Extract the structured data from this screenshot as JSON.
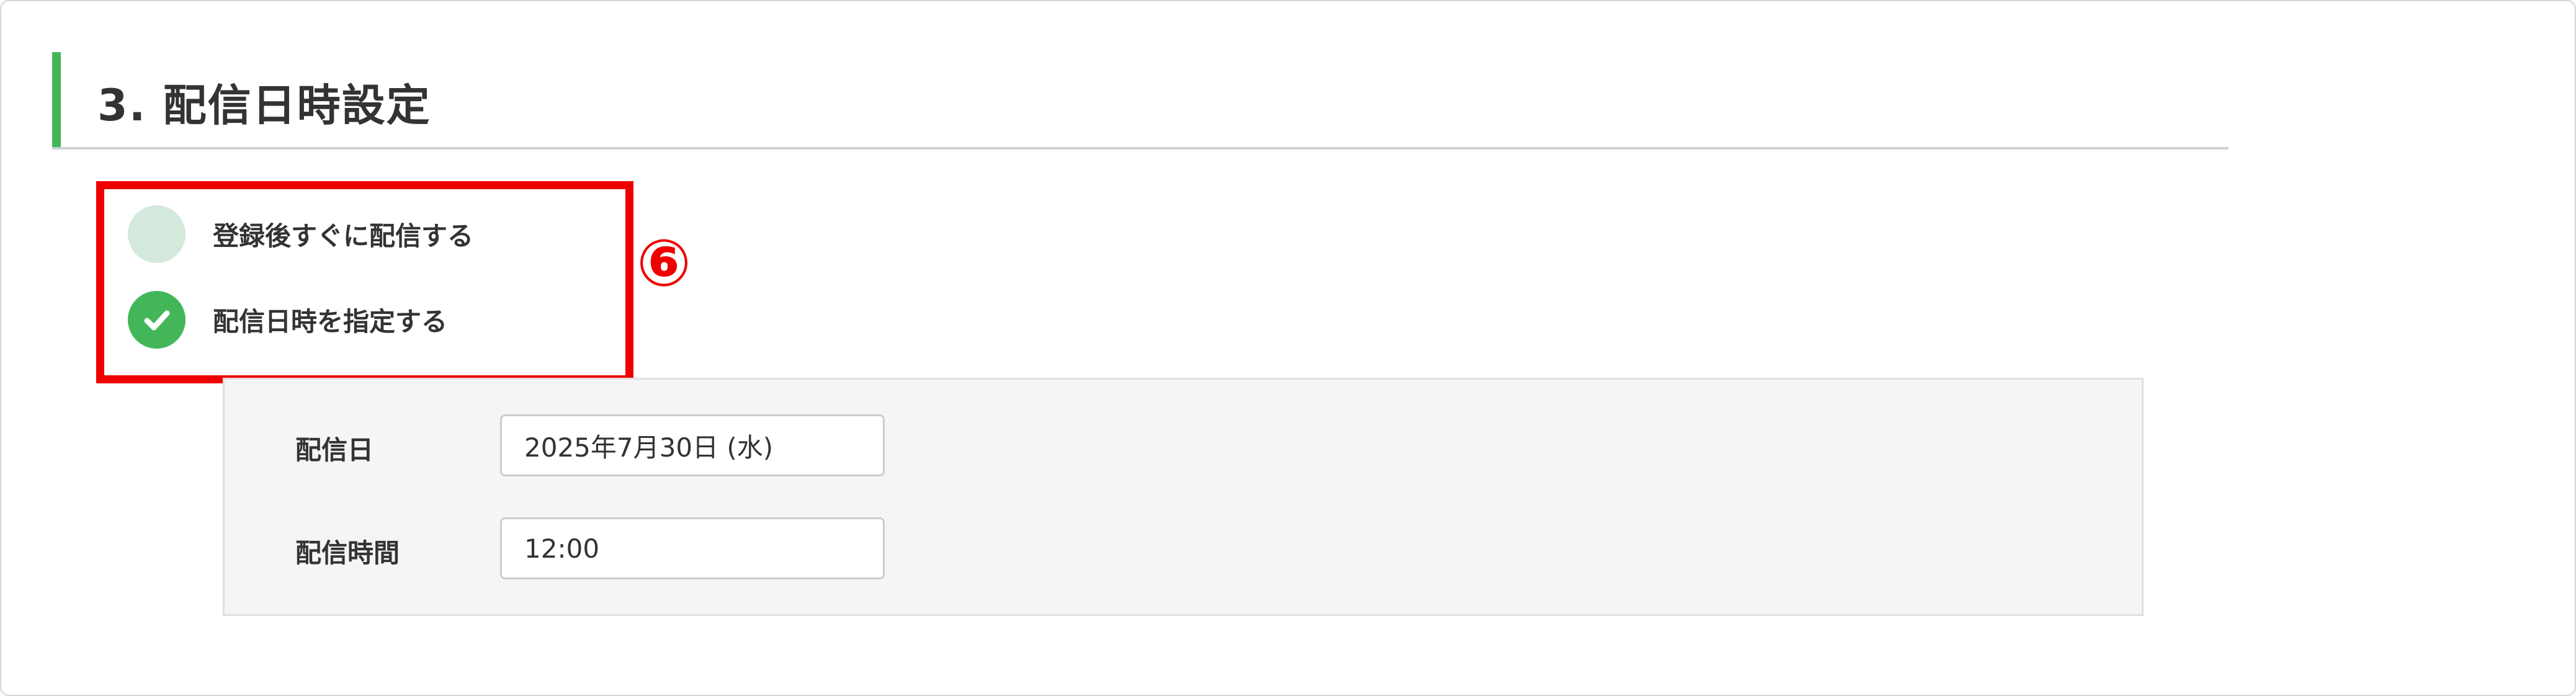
{
  "section": {
    "title": "3. 配信日時設定"
  },
  "delivery_timing": {
    "options": [
      {
        "label": "登録後すぐに配信する",
        "selected": false
      },
      {
        "label": "配信日時を指定する",
        "selected": true
      }
    ],
    "callout": "⑥"
  },
  "schedule": {
    "date_label": "配信日",
    "date_value": "2025年7月30日 (水)",
    "time_label": "配信時間",
    "time_value": "12:00"
  },
  "colors": {
    "accent": "#44b65a",
    "radio_unselected": "#d3e9dc",
    "highlight": "#ee0000",
    "panel_background": "#f5f5f5"
  },
  "icons": {
    "selected_radio": "checkmark-icon"
  }
}
